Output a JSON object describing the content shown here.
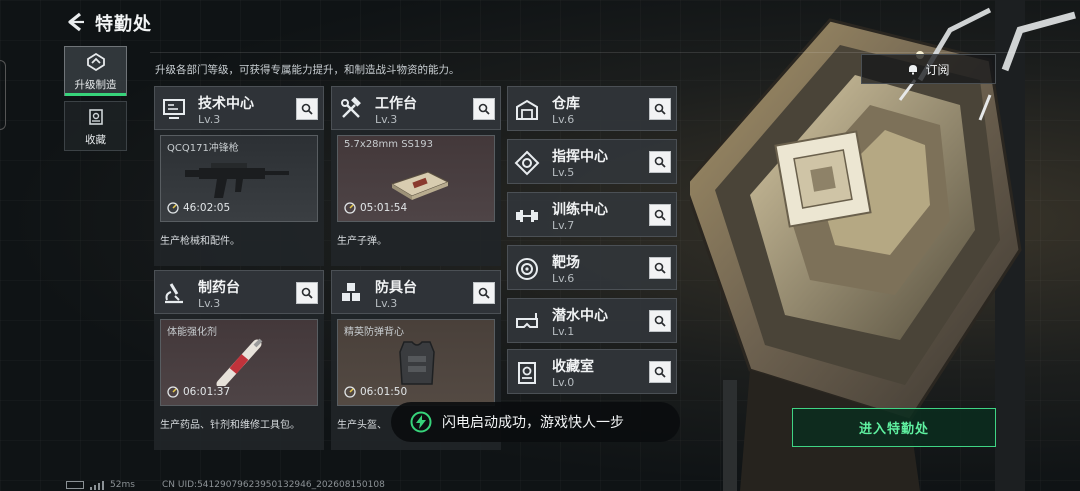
{
  "header": {
    "title": "特勤处",
    "subtitle": "升级各部门等级，可获得专属能力提升，和制造战斗物资的能力。"
  },
  "side_tabs": [
    {
      "label": "升级制造",
      "icon": "upgrade-icon",
      "active": true
    },
    {
      "label": "收藏",
      "icon": "collection-icon",
      "active": false
    }
  ],
  "subscribe_label": "订阅",
  "big_cards": [
    {
      "name": "技术中心",
      "level": "Lv.3",
      "icon": "monitor-icon",
      "item_name": "QCQ171冲锋枪",
      "timer": "46:02:05",
      "desc": "生产枪械和配件。"
    },
    {
      "name": "工作台",
      "level": "Lv.3",
      "icon": "tools-icon",
      "item_name": "5.7x28mm SS193",
      "timer": "05:01:54",
      "desc": "生产子弹。"
    },
    {
      "name": "制药台",
      "level": "Lv.3",
      "icon": "microscope-icon",
      "item_name": "体能强化剂",
      "timer": "06:01:37",
      "desc": "生产药品、针剂和维修工具包。"
    },
    {
      "name": "防具台",
      "level": "Lv.3",
      "icon": "boxes-icon",
      "item_name": "精英防弹背心",
      "timer": "06:01:50",
      "desc": "生产头盔、"
    }
  ],
  "rows": [
    {
      "name": "仓库",
      "level": "Lv.6",
      "icon": "warehouse-icon"
    },
    {
      "name": "指挥中心",
      "level": "Lv.5",
      "icon": "command-icon"
    },
    {
      "name": "训练中心",
      "level": "Lv.7",
      "icon": "dumbbell-icon"
    },
    {
      "name": "靶场",
      "level": "Lv.6",
      "icon": "target-icon"
    },
    {
      "name": "潜水中心",
      "level": "Lv.1",
      "icon": "dive-mask-icon"
    },
    {
      "name": "收藏室",
      "level": "Lv.0",
      "icon": "showcase-icon"
    }
  ],
  "enter_label": "进入特勤处",
  "toast": {
    "message": "闪电启动成功，游戏快人一步",
    "icon": "lightning-icon"
  },
  "footer": {
    "latency": "52ms",
    "uid": "CN UID:5412907962395013294​6_202608150108"
  },
  "colors": {
    "accent": "#37d37a",
    "enter_text": "#5ff0a0"
  }
}
